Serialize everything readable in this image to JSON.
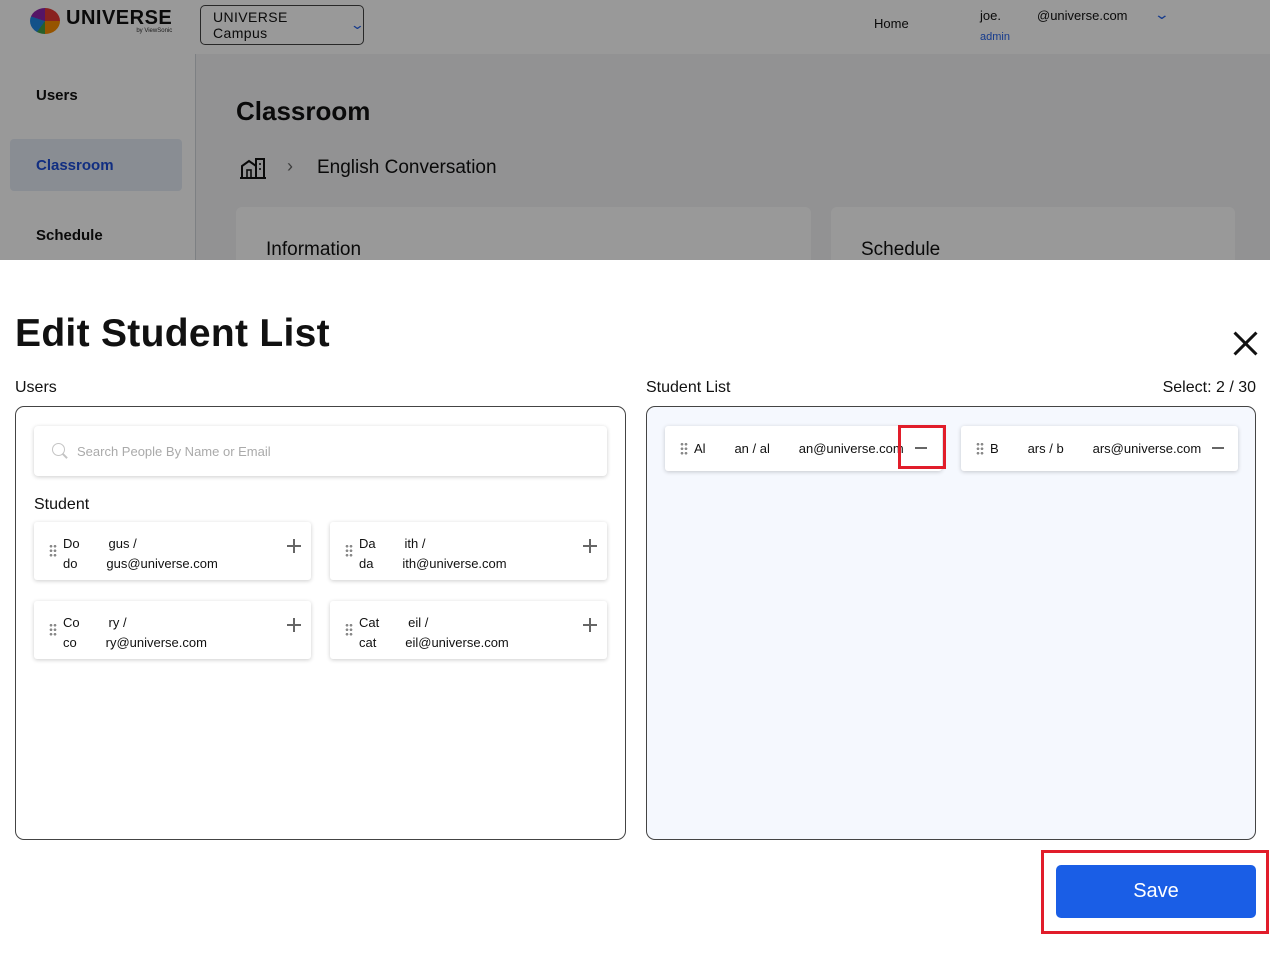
{
  "topbar": {
    "logo_text": "UNIVERSE",
    "logo_sub": "by ViewSonic",
    "campus_label": "UNIVERSE Campus",
    "home_label": "Home",
    "user_name": "joe.",
    "user_email": "@universe.com",
    "user_role": "admin"
  },
  "sidebar": {
    "items": [
      {
        "label": "Users"
      },
      {
        "label": "Classroom"
      },
      {
        "label": "Schedule"
      }
    ]
  },
  "main": {
    "title": "Classroom",
    "breadcrumb": "English Conversation",
    "cards": [
      {
        "title": "Information"
      },
      {
        "title": "Schedule"
      }
    ]
  },
  "modal": {
    "title": "Edit Student List",
    "users_label": "Users",
    "student_list_label": "Student List",
    "select_count": "Select: 2 / 30",
    "search_placeholder": "Search People By Name or Email",
    "student_heading": "Student",
    "users": [
      {
        "line1": "Do        gus /",
        "line2": "do        gus@universe.com"
      },
      {
        "line1": "Da        ith /",
        "line2": "da        ith@universe.com"
      },
      {
        "line1": "Co        ry /",
        "line2": "co        ry@universe.com"
      },
      {
        "line1": "Cat        eil /",
        "line2": "cat        eil@universe.com"
      }
    ],
    "selected": [
      {
        "text": "Al        an / al        an@universe.com"
      },
      {
        "text": "B        ars / b        ars@universe.com"
      }
    ],
    "save_label": "Save"
  },
  "colors": {
    "accent": "#1a5ee6",
    "highlight": "#e11d2a",
    "list_bg": "#f5f8fe"
  }
}
